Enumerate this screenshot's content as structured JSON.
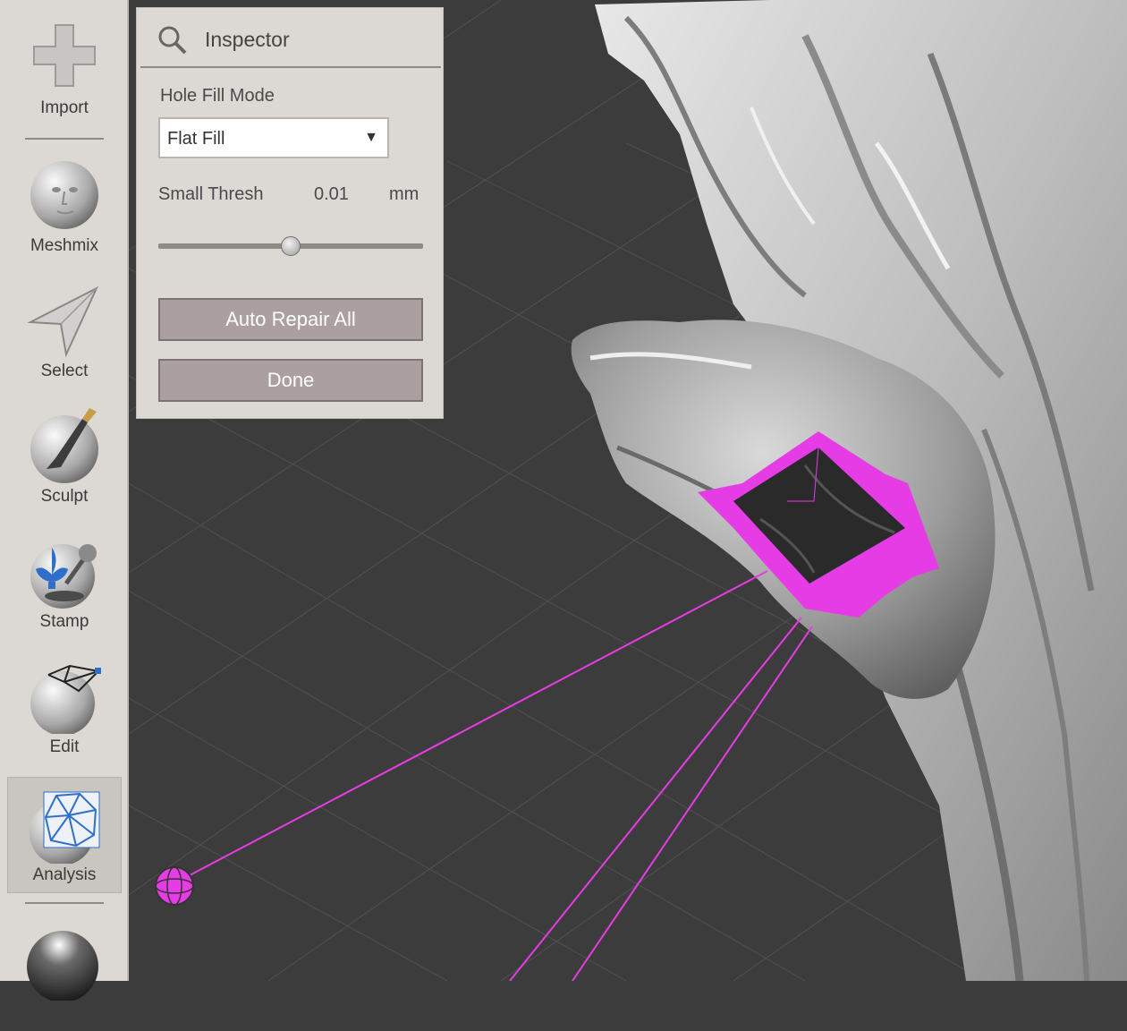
{
  "toolbar": {
    "items": [
      {
        "label": "Import",
        "icon": "plus-icon"
      },
      {
        "label": "Meshmix",
        "icon": "meshmix-face-icon"
      },
      {
        "label": "Select",
        "icon": "arrow-cursor-icon"
      },
      {
        "label": "Sculpt",
        "icon": "brush-sphere-icon"
      },
      {
        "label": "Stamp",
        "icon": "fleur-de-lis-stamp-icon"
      },
      {
        "label": "Edit",
        "icon": "wireframe-sphere-icon"
      },
      {
        "label": "Analysis",
        "icon": "mesh-analysis-icon"
      },
      {
        "label": "",
        "icon": "shaders-sphere-icon"
      }
    ],
    "active": "Analysis"
  },
  "inspector": {
    "title": "Inspector",
    "icon": "magnifier-icon",
    "hole_fill_mode_label": "Hole Fill Mode",
    "hole_fill_mode_value": "Flat Fill",
    "small_thresh_label": "Small Thresh",
    "small_thresh_value": "0.01",
    "small_thresh_unit": "mm",
    "slider_fraction": 0.5,
    "auto_repair_label": "Auto Repair All",
    "done_label": "Done"
  },
  "colors": {
    "viewport_bg": "#3d3c3c",
    "panel_bg": "#dcd8d3",
    "button_bg": "#ab9f9f",
    "highlight": "#e63ce6"
  }
}
